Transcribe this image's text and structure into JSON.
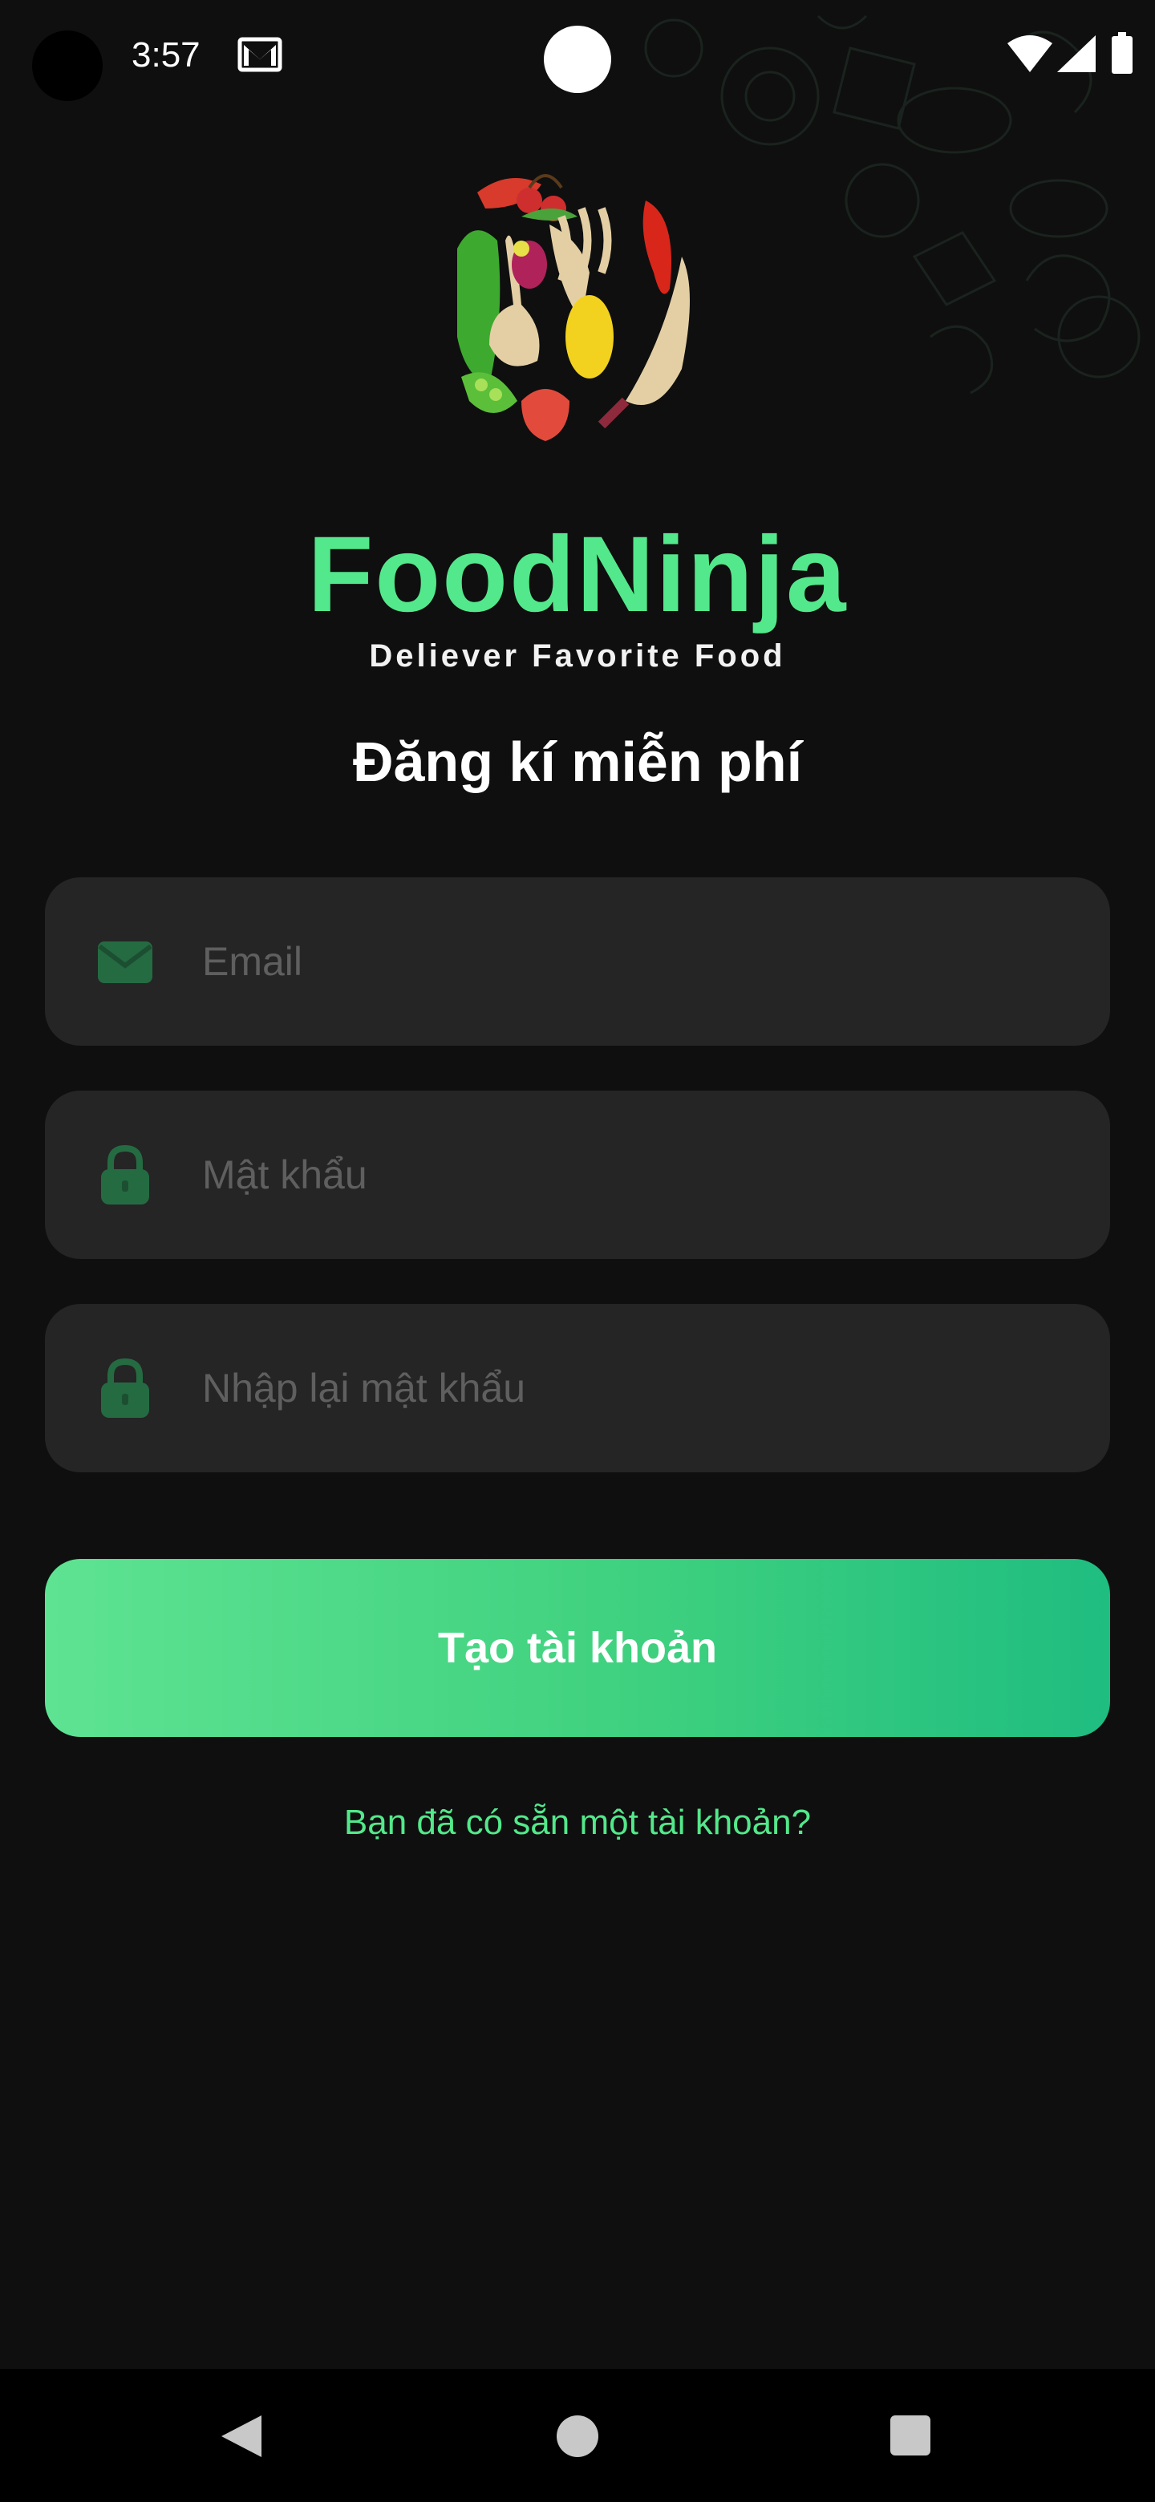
{
  "status_bar": {
    "time": "3:57"
  },
  "brand": {
    "name": "FoodNinja",
    "tagline": "Deliever Favorite Food"
  },
  "form": {
    "title": "Đăng kí miễn phí",
    "email_placeholder": "Email",
    "password_placeholder": "Mật khẩu",
    "confirm_password_placeholder": "Nhập lại mật khẩu",
    "submit_label": "Tạo tài khoản",
    "login_link": "Bạn đã có sẵn một tài khoản?"
  },
  "colors": {
    "background": "#0f0f0f",
    "accent": "#53e88b",
    "field_background": "#252525",
    "button_gradient": [
      "#5ee392",
      "#1fbd80"
    ]
  },
  "icons": [
    "mail-icon",
    "wifi-icon",
    "signal-icon",
    "battery-icon",
    "envelope-icon",
    "lock-icon",
    "back-icon",
    "home-icon",
    "recents-icon"
  ]
}
